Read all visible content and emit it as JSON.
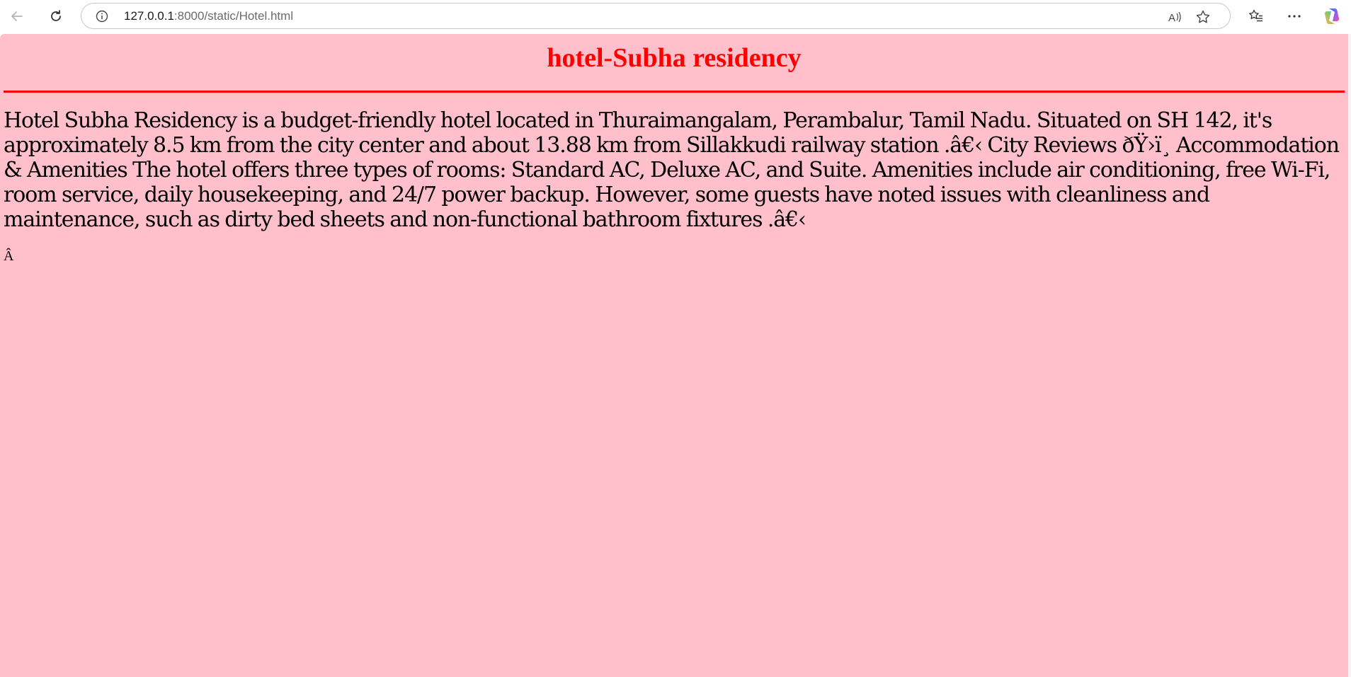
{
  "browser": {
    "url_host": "127.0.0.1",
    "url_rest": ":8000/static/Hotel.html",
    "icons": [
      "back-arrow-icon",
      "refresh-icon",
      "info-icon",
      "read-aloud-icon",
      "favorite-star-icon",
      "favorites-list-icon",
      "more-options-icon",
      "copilot-icon"
    ]
  },
  "page": {
    "background": "#ffc0cb",
    "accent": "#ff0000",
    "title": "hotel-Subha residency",
    "body": "Hotel Subha Residency is a budget-friendly hotel located in Thuraimangalam, Perambalur, Tamil Nadu. Situated on SH 142, it's approximately 8.5 km from the city center and about 13.88 km from Sillakkudi railway station .â€‹ City Reviews ðŸ›ï¸ Accommodation & Amenities The hotel offers three types of rooms: Standard AC, Deluxe AC, and Suite. Amenities include air conditioning, free Wi-Fi, room service, daily housekeeping, and 24/7 power backup. However, some guests have noted issues with cleanliness and maintenance, such as dirty bed sheets and non-functional bathroom fixtures .â€‹",
    "footer_char": "Â"
  }
}
